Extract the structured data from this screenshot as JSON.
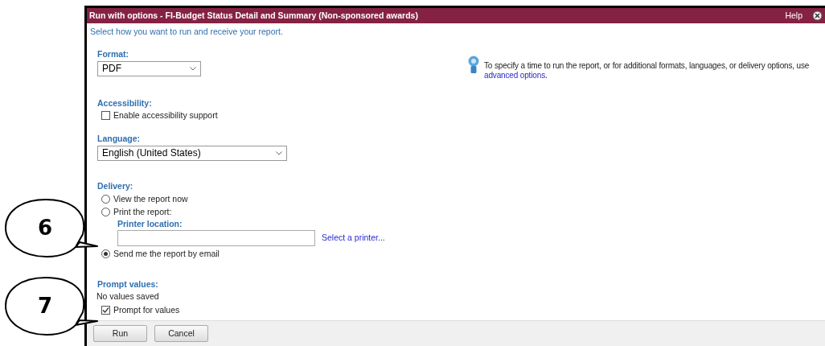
{
  "window": {
    "title": "Run with options - FI-Budget Status Detail and Summary (Non-sponsored awards)",
    "help": "Help"
  },
  "subtitle": "Select how you want to run and receive your report.",
  "format": {
    "label": "Format:",
    "value": "PDF"
  },
  "accessibility": {
    "label": "Accessibility:",
    "option": {
      "label": "Enable accessibility support",
      "checked": false
    }
  },
  "language": {
    "label": "Language:",
    "value": "English (United States)"
  },
  "delivery": {
    "label": "Delivery:",
    "options": [
      {
        "label": "View the report now",
        "selected": false
      },
      {
        "label": "Print the report:",
        "selected": false,
        "printer": {
          "label": "Printer location:",
          "link": "Select a printer..."
        }
      },
      {
        "label": "Send me the report by email",
        "selected": true
      }
    ]
  },
  "prompt_values": {
    "label": "Prompt values:",
    "status": "No values saved",
    "option": {
      "label": "Prompt for values",
      "checked": true
    }
  },
  "info": {
    "text": "To specify a time to run the report, or for additional formats, languages, or delivery options, use",
    "link": "advanced options",
    "suffix": "."
  },
  "buttons": [
    "Run",
    "Cancel"
  ],
  "callouts": [
    {
      "number": "6"
    },
    {
      "number": "7"
    }
  ]
}
